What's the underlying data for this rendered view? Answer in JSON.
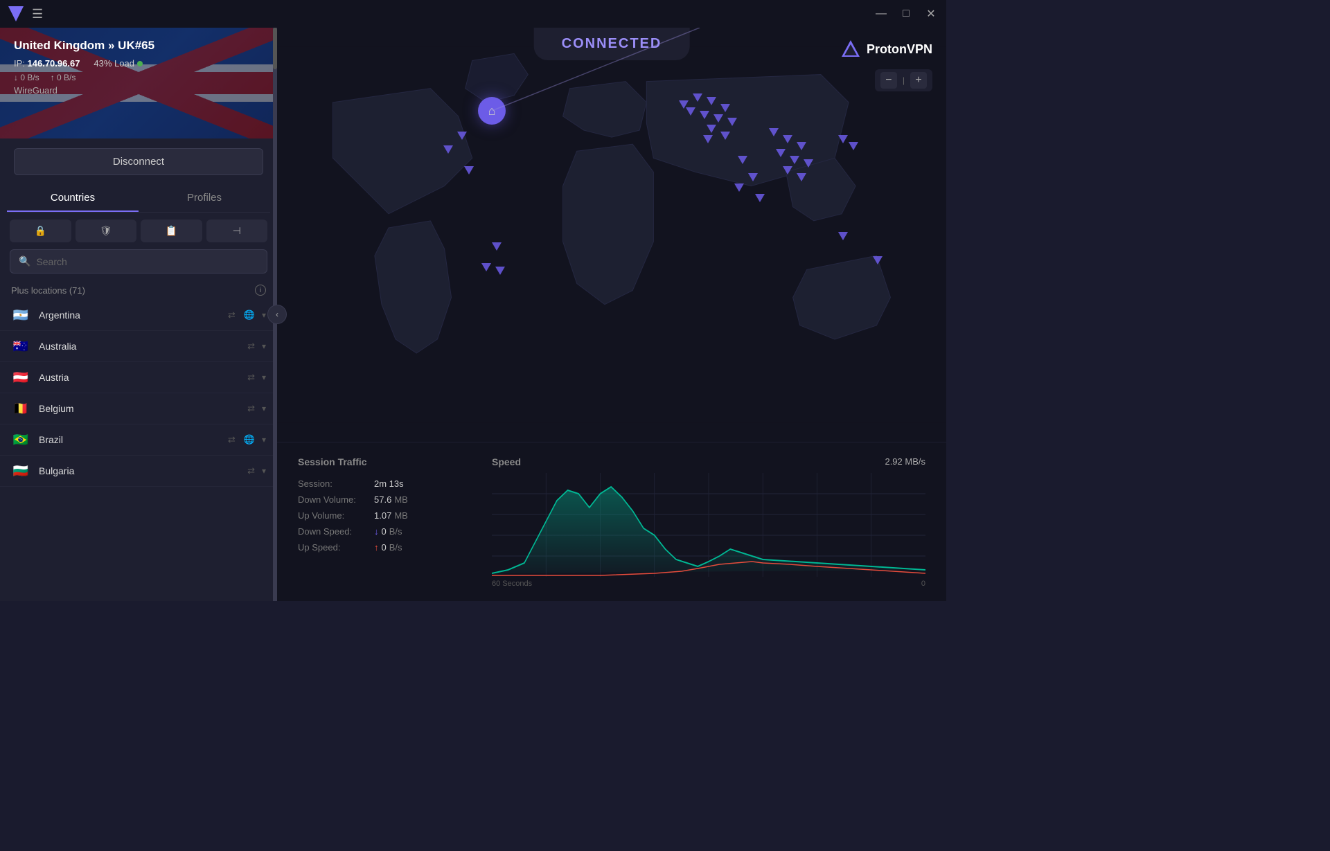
{
  "titleBar": {
    "minimize": "—",
    "maximize": "□",
    "close": "✕"
  },
  "sidebar": {
    "server": "United Kingdom » UK#65",
    "ip_label": "IP: ",
    "ip": "146.70.96.67",
    "load": "43% Load",
    "protocol": "WireGuard",
    "down": "↓ 0 B/s",
    "up": "↑ 0 B/s",
    "disconnect_label": "Disconnect",
    "tabs": [
      "Countries",
      "Profiles"
    ],
    "active_tab": "Countries",
    "filters": [
      "🔒",
      "🛡",
      "📋",
      "⊣"
    ],
    "search_placeholder": "Search",
    "section_label": "Plus locations (71)",
    "countries": [
      {
        "flag": "🇦🇷",
        "name": "Argentina",
        "has_globe": true,
        "has_p2p": false
      },
      {
        "flag": "🇦🇺",
        "name": "Australia",
        "has_globe": false,
        "has_p2p": false
      },
      {
        "flag": "🇦🇹",
        "name": "Austria",
        "has_globe": false,
        "has_p2p": false
      },
      {
        "flag": "🇧🇪",
        "name": "Belgium",
        "has_globe": false,
        "has_p2p": false
      },
      {
        "flag": "🇧🇷",
        "name": "Brazil",
        "has_globe": true,
        "has_p2p": false
      },
      {
        "flag": "🇧🇬",
        "name": "Bulgaria",
        "has_globe": false,
        "has_p2p": false
      }
    ]
  },
  "map": {
    "connected_text": "CONNECTED",
    "logo_text": "ProtonVPN",
    "zoom_label": "|"
  },
  "stats": {
    "session_traffic_title": "Session Traffic",
    "speed_title": "Speed",
    "speed_value": "2.92 MB/s",
    "session_label": "Session:",
    "session_value": "2m 13s",
    "down_vol_label": "Down Volume:",
    "down_vol_value": "57.6",
    "down_vol_unit": "MB",
    "up_vol_label": "Up Volume:",
    "up_vol_value": "1.07",
    "up_vol_unit": "MB",
    "down_speed_label": "Down Speed:",
    "down_speed_value": "0",
    "down_speed_unit": "B/s",
    "up_speed_label": "Up Speed:",
    "up_speed_value": "0",
    "up_speed_unit": "B/s",
    "chart_left": "60 Seconds",
    "chart_right": "0"
  }
}
